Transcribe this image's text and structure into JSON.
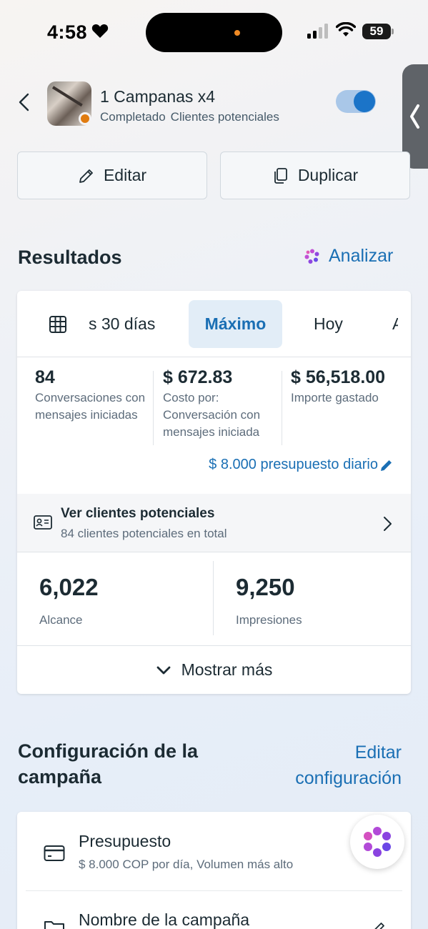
{
  "status_bar": {
    "time": "4:58",
    "battery": "59"
  },
  "header": {
    "title": "1 Campanas x4",
    "status": "Completado",
    "objective": "Clientes potenciales",
    "toggle_on": true,
    "accent": "#1b74c8"
  },
  "actions": {
    "edit_label": "Editar",
    "duplicate_label": "Duplicar"
  },
  "results": {
    "title": "Resultados",
    "analyze_label": "Analizar",
    "tabs": [
      {
        "label": "s 30 días",
        "icon": "calendar-grid-icon"
      },
      {
        "label": "Máximo",
        "selected": true
      },
      {
        "label": "Hoy"
      },
      {
        "label": "A"
      }
    ],
    "metrics": [
      {
        "value": "84",
        "label": "Conversaciones con mensajes iniciadas"
      },
      {
        "value": "$ 672.83",
        "label": "Costo por: Conversación con mensajes iniciada"
      },
      {
        "value": "$ 56,518.00",
        "label": "Importe gastado"
      }
    ],
    "budget_link": "$ 8.000 presupuesto diario",
    "leads": {
      "title": "Ver clientes potenciales",
      "subtitle": "84 clientes potenciales en total"
    },
    "stats": [
      {
        "value": "6,022",
        "label": "Alcance"
      },
      {
        "value": "9,250",
        "label": "Impresiones"
      }
    ],
    "show_more": "Mostrar más"
  },
  "config": {
    "title": "Configuración de la campaña",
    "edit_line1": "Editar",
    "edit_line2": "configuración",
    "items": [
      {
        "title": "Presupuesto",
        "subtitle": "$ 8.000 COP por día, Volumen más alto",
        "icon": "credit-card-icon"
      },
      {
        "title": "Nombre de la campaña",
        "icon": "folder-icon"
      }
    ]
  },
  "colors": {
    "link": "#1a6fb4",
    "selected_tab_bg": "#e2edf7"
  }
}
